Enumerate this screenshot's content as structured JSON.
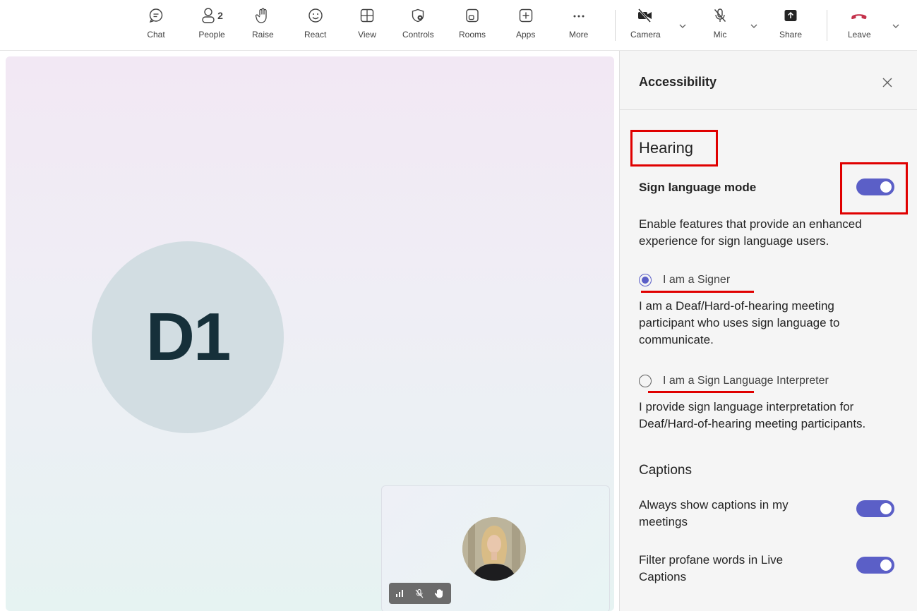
{
  "toolbar": {
    "chat": "Chat",
    "people": "People",
    "people_count": "2",
    "raise": "Raise",
    "react": "React",
    "view": "View",
    "controls": "Controls",
    "rooms": "Rooms",
    "apps": "Apps",
    "more": "More",
    "camera": "Camera",
    "mic": "Mic",
    "share": "Share",
    "leave": "Leave"
  },
  "stage": {
    "avatar_initials": "D1"
  },
  "panel": {
    "title": "Accessibility",
    "hearing": {
      "heading": "Hearing",
      "sign_language_mode": {
        "label": "Sign language mode",
        "enabled": true,
        "description": "Enable features that provide an enhanced experience for sign language users."
      },
      "options": [
        {
          "label": "I am a Signer",
          "selected": true,
          "description": "I am a Deaf/Hard-of-hearing meeting participant who uses sign language to communicate."
        },
        {
          "label": "I am a Sign Language Interpreter",
          "selected": false,
          "description": "I provide sign language interpretation for Deaf/Hard-of-hearing meeting participants."
        }
      ]
    },
    "captions": {
      "heading": "Captions",
      "always_show": {
        "label": "Always show captions in my meetings",
        "enabled": true
      },
      "filter_profane": {
        "label": "Filter profane words in Live Captions",
        "enabled": true
      }
    }
  },
  "colors": {
    "accent": "#5b5fc7",
    "annotation": "#e00000",
    "leave": "#c4314b"
  }
}
